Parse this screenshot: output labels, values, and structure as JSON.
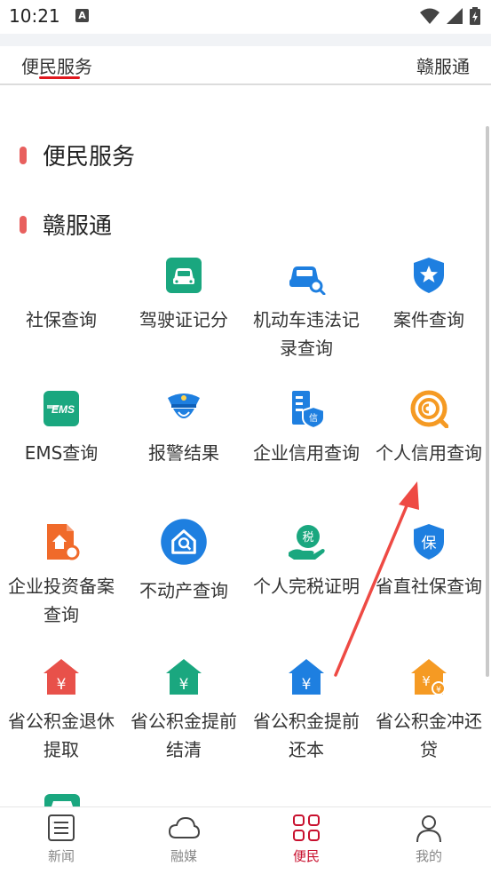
{
  "status_bar": {
    "time": "10:21",
    "sim_letter": "A"
  },
  "tabs": [
    {
      "label": "便民服务",
      "active": true
    },
    {
      "label": "赣服通",
      "active": false
    }
  ],
  "sections": [
    {
      "title": "便民服务"
    },
    {
      "title": "赣服通"
    }
  ],
  "grid": [
    {
      "label": "社保查询",
      "icon": "social-security-icon"
    },
    {
      "label": "驾驶证记分",
      "icon": "car-icon"
    },
    {
      "label": "机动车违法记录查询",
      "icon": "car-search-icon"
    },
    {
      "label": "案件查询",
      "icon": "police-shield-icon"
    },
    {
      "label": "EMS查询",
      "icon": "ems-icon"
    },
    {
      "label": "报警结果",
      "icon": "police-officer-icon"
    },
    {
      "label": "企业信用查询",
      "icon": "enterprise-credit-icon"
    },
    {
      "label": "个人信用查询",
      "icon": "personal-credit-icon"
    },
    {
      "label": "企业投资备案查询",
      "icon": "enterprise-investment-icon"
    },
    {
      "label": "不动产查询",
      "icon": "real-estate-icon"
    },
    {
      "label": "个人完税证明",
      "icon": "tax-certificate-icon"
    },
    {
      "label": "省直社保查询",
      "icon": "provincial-social-security-icon"
    },
    {
      "label": "省公积金退休提取",
      "icon": "fund-retire-icon"
    },
    {
      "label": "省公积金提前结清",
      "icon": "fund-settle-icon"
    },
    {
      "label": "省公积金提前还本",
      "icon": "fund-repay-icon"
    },
    {
      "label": "省公积金冲还贷",
      "icon": "fund-offset-icon"
    }
  ],
  "bottom_nav": [
    {
      "label": "新闻",
      "icon": "news-icon",
      "active": false
    },
    {
      "label": "融媒",
      "icon": "cloud-icon",
      "active": false
    },
    {
      "label": "便民",
      "icon": "grid-icon",
      "active": true
    },
    {
      "label": "我的",
      "icon": "person-icon",
      "active": false
    }
  ],
  "colors": {
    "accent_red": "#e0181e",
    "section_mark": "#e8605e",
    "active_nav": "#c8102e",
    "teal": "#1aa77f",
    "blue": "#1e7fe0",
    "orange": "#f06a2a"
  }
}
